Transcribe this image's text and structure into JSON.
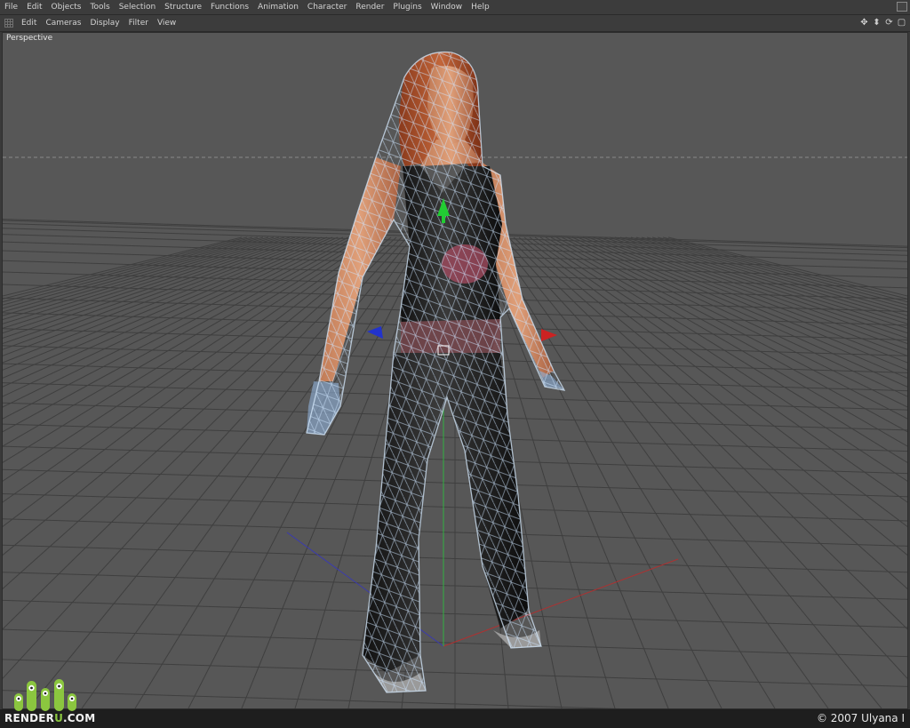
{
  "menu": [
    "File",
    "Edit",
    "Objects",
    "Tools",
    "Selection",
    "Structure",
    "Functions",
    "Animation",
    "Character",
    "Render",
    "Plugins",
    "Window",
    "Help"
  ],
  "view_menu": [
    "Edit",
    "Cameras",
    "Display",
    "Filter",
    "View"
  ],
  "viewport_label": "Perspective",
  "toolbar_icons": [
    "move-view-icon",
    "zoom-view-icon",
    "rotate-view-icon",
    "maximize-view-icon"
  ],
  "logo": {
    "prefix": "RENDER",
    "accent": "U",
    "suffix": ".COM"
  },
  "copyright": "© 2007 Ulyana I",
  "colors": {
    "axis_y": "#22cc33",
    "axis_x": "#cc2222",
    "axis_z": "#2233cc",
    "wire": "#cfe6ff",
    "logo_green": "#8bc63f"
  }
}
